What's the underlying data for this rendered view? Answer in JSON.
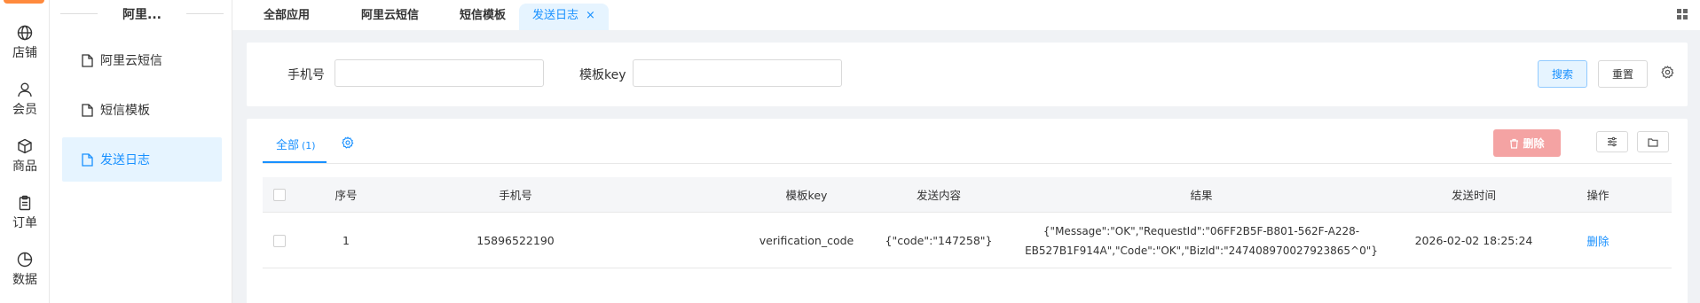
{
  "rail": {
    "items": [
      {
        "label": "店铺",
        "icon": "globe-icon"
      },
      {
        "label": "会员",
        "icon": "user-icon"
      },
      {
        "label": "商品",
        "icon": "box-icon"
      },
      {
        "label": "订单",
        "icon": "clipboard-icon"
      },
      {
        "label": "数据",
        "icon": "chart-icon"
      }
    ]
  },
  "submenu": {
    "title": "阿里...",
    "items": [
      {
        "label": "阿里云短信",
        "icon": "file-icon"
      },
      {
        "label": "短信模板",
        "icon": "file-icon"
      },
      {
        "label": "发送日志",
        "icon": "file-icon",
        "active": true
      }
    ]
  },
  "tabs": [
    {
      "label": "全部应用"
    },
    {
      "label": "阿里云短信"
    },
    {
      "label": "短信模板"
    },
    {
      "label": "发送日志",
      "active": true,
      "close": "×"
    }
  ],
  "search": {
    "phone_label": "手机号",
    "phone_value": "",
    "template_label": "模板key",
    "template_value": "",
    "search_button": "搜索",
    "reset_button": "重置"
  },
  "list": {
    "tab_label": "全部",
    "tab_count": "(1)",
    "delete_button": "删除"
  },
  "table": {
    "columns": [
      "序号",
      "手机号",
      "模板key",
      "发送内容",
      "结果",
      "发送时间",
      "操作"
    ],
    "rows": [
      {
        "index": "1",
        "phone": "15896522190",
        "template_key": "verification_code",
        "content": "{\"code\":\"147258\"}",
        "result_line1": "{\"Message\":\"OK\",\"RequestId\":\"06FF2B5F-B801-562F-A228-",
        "result_line2": "EB527B1F914A\",\"Code\":\"OK\",\"BizId\":\"247408970027923865^0\"}",
        "send_time": "2026-02-02 18:25:24",
        "action": "删除"
      }
    ]
  },
  "colors": {
    "accent": "#1890ff",
    "active_bg": "#e6f4ff",
    "danger_disabled": "#f4a3a3",
    "brand_orange": "#ff8a3d"
  }
}
